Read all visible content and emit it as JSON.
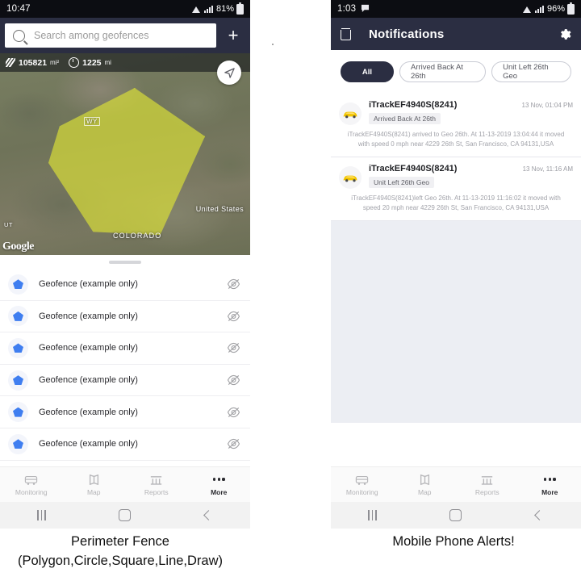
{
  "left_phone": {
    "status_bar": {
      "clock": "10:47",
      "battery": "81%"
    },
    "search": {
      "placeholder": "Search among geofences",
      "icon": "search-icon",
      "add_label": "+"
    },
    "map": {
      "area_value": "105821",
      "area_unit": "mi²",
      "perimeter_value": "1225",
      "perimeter_unit": "mi",
      "labels": {
        "state_wy": "WY",
        "country": "United States",
        "state_co": "COLORADO",
        "state_ut": "UT"
      },
      "watermark": "Google",
      "polygon_color": "#dee437",
      "compass_icon": "navigation-arrow-icon"
    },
    "geofence_list": [
      {
        "name": "Geofence (example only)"
      },
      {
        "name": "Geofence (example only)"
      },
      {
        "name": "Geofence (example only)"
      },
      {
        "name": "Geofence (example only)"
      },
      {
        "name": "Geofence (example only)"
      },
      {
        "name": "Geofence (example only)"
      }
    ],
    "bottom_nav": [
      {
        "label": "Monitoring",
        "icon": "bus-icon",
        "active": false
      },
      {
        "label": "Map",
        "icon": "map-icon",
        "active": false
      },
      {
        "label": "Reports",
        "icon": "reports-icon",
        "active": false
      },
      {
        "label": "More",
        "icon": "more-dots-icon",
        "active": true
      }
    ]
  },
  "right_phone": {
    "status_bar": {
      "clock": "1:03",
      "battery": "96%"
    },
    "app_bar": {
      "title": "Notifications",
      "delete_icon": "trash-icon",
      "settings_icon": "gear-icon"
    },
    "chips": [
      {
        "label": "All",
        "active": true
      },
      {
        "label": "Arrived Back At 26th",
        "active": false
      },
      {
        "label": "Unit Left 26th Geo",
        "active": false
      }
    ],
    "notifications": [
      {
        "title": "iTrackEF4940S(8241)",
        "time": "13 Nov, 01:04 PM",
        "tag": "Arrived Back At 26th",
        "body": "iTrackEF4940S(8241) arrived to Geo 26th.     At 11-13-2019 13:04:44 it moved with speed 0 mph near 4229 26th St, San Francisco, CA 94131,USA",
        "avatar_icon": "car-icon"
      },
      {
        "title": "iTrackEF4940S(8241)",
        "time": "13 Nov, 11:16 AM",
        "tag": "Unit Left 26th Geo",
        "body": "iTrackEF4940S(8241)left Geo 26th.     At 11-13-2019 11:16:02 it moved with speed 20 mph near 4229 26th St, San Francisco, CA 94131,USA",
        "avatar_icon": "car-icon"
      }
    ],
    "bottom_nav": [
      {
        "label": "Monitoring",
        "icon": "bus-icon",
        "active": false
      },
      {
        "label": "Map",
        "icon": "map-icon",
        "active": false
      },
      {
        "label": "Reports",
        "icon": "reports-icon",
        "active": false
      },
      {
        "label": "More",
        "icon": "more-dots-icon",
        "active": true
      }
    ]
  },
  "captions": {
    "left_line1": "Perimeter Fence",
    "left_line2": "(Polygon,Circle,Square,Line,Draw)",
    "right_line1": "Mobile Phone Alerts!"
  },
  "colors": {
    "app_bar": "#2b2e42",
    "accent_blue": "#3f7ef0",
    "polygon": "#dee437",
    "notif_bg": "#eceef3"
  }
}
